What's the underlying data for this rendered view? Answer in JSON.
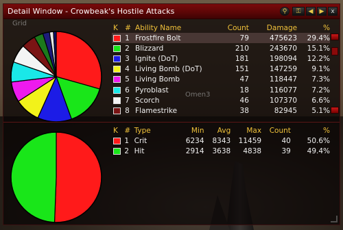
{
  "window": {
    "title": "Detail Window - Crowbeak's Hostile Attacks"
  },
  "toolbar": {
    "search_icon": "magnifier-icon",
    "key_icon": "key-icon",
    "prev_icon": "arrow-left-icon",
    "next_icon": "arrow-right-icon",
    "close_label": "x"
  },
  "overlay": {
    "grid_label": "Grid",
    "omen_label": "Omen3"
  },
  "abilities": {
    "headers": {
      "k": "K",
      "num": "#",
      "name": "Ability Name",
      "count": "Count",
      "damage": "Damage",
      "pct": "%"
    },
    "rows": [
      {
        "num": "1",
        "name": "Frostfire Bolt",
        "count": "79",
        "damage": "475623",
        "pct": "29.4%",
        "color": "#ff1a1a"
      },
      {
        "num": "2",
        "name": "Blizzard",
        "count": "210",
        "damage": "243670",
        "pct": "15.1%",
        "color": "#19e619"
      },
      {
        "num": "3",
        "name": "Ignite (DoT)",
        "count": "181",
        "damage": "198094",
        "pct": "12.2%",
        "color": "#1c1ce6"
      },
      {
        "num": "4",
        "name": "Living Bomb (DoT)",
        "count": "151",
        "damage": "147259",
        "pct": "9.1%",
        "color": "#f2f21a"
      },
      {
        "num": "5",
        "name": "Living Bomb",
        "count": "47",
        "damage": "118447",
        "pct": "7.3%",
        "color": "#ee1aee"
      },
      {
        "num": "6",
        "name": "Pyroblast",
        "count": "18",
        "damage": "116077",
        "pct": "7.2%",
        "color": "#1ae8e8"
      },
      {
        "num": "7",
        "name": "Scorch",
        "count": "46",
        "damage": "107370",
        "pct": "6.6%",
        "color": "#f4f4f4"
      },
      {
        "num": "8",
        "name": "Flamestrike",
        "count": "38",
        "damage": "82945",
        "pct": "5.1%",
        "color": "#7a1414"
      }
    ]
  },
  "hits": {
    "headers": {
      "k": "K",
      "num": "#",
      "type": "Type",
      "min": "Min",
      "avg": "Avg",
      "max": "Max",
      "count": "Count",
      "pct": "%"
    },
    "rows": [
      {
        "num": "1",
        "type": "Crit",
        "min": "6234",
        "avg": "8343",
        "max": "11459",
        "count": "40",
        "pct": "50.6%",
        "color": "#ff1a1a"
      },
      {
        "num": "2",
        "type": "Hit",
        "min": "2914",
        "avg": "3638",
        "max": "4838",
        "count": "39",
        "pct": "49.4%",
        "color": "#19e619"
      }
    ]
  },
  "chart_data": [
    {
      "type": "pie",
      "categories": [
        "Frostfire Bolt",
        "Blizzard",
        "Ignite (DoT)",
        "Living Bomb (DoT)",
        "Living Bomb",
        "Pyroblast",
        "Scorch",
        "Flamestrike",
        "other",
        "other",
        "other",
        "other"
      ],
      "values": [
        29.4,
        15.1,
        12.2,
        9.1,
        7.3,
        7.2,
        6.6,
        5.1,
        3.2,
        2.4,
        1.4,
        1.0
      ],
      "colors": [
        "#ff1a1a",
        "#19e619",
        "#1c1ce6",
        "#f2f21a",
        "#ee1aee",
        "#1ae8e8",
        "#f4f4f4",
        "#7a1414",
        "#1c7a1c",
        "#1c1c7a",
        "#e8e8e8",
        "#11116e"
      ]
    },
    {
      "type": "pie",
      "categories": [
        "Crit",
        "Hit"
      ],
      "values": [
        50.6,
        49.4
      ],
      "colors": [
        "#ff1a1a",
        "#19e619"
      ]
    }
  ]
}
